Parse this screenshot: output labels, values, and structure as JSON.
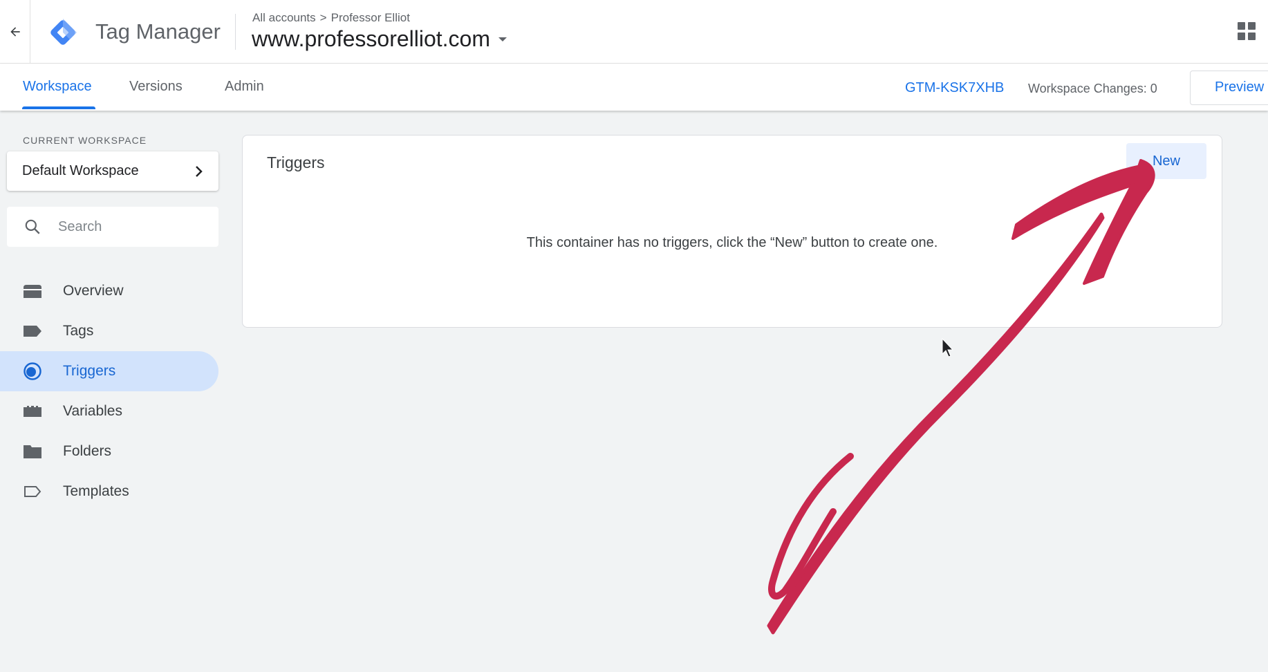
{
  "header": {
    "app_name": "Tag Manager",
    "breadcrumb": {
      "accounts": "All accounts",
      "separator": ">",
      "account": "Professor Elliot"
    },
    "container_name": "www.professorelliot.com"
  },
  "tabs": {
    "workspace": "Workspace",
    "versions": "Versions",
    "admin": "Admin",
    "active": "Workspace"
  },
  "toolbar": {
    "container_id": "GTM-KSK7XHB",
    "workspace_changes": "Workspace Changes: 0",
    "preview_label": "Preview"
  },
  "sidebar": {
    "current_workspace_label": "CURRENT WORKSPACE",
    "workspace_name": "Default Workspace",
    "search_placeholder": "Search",
    "items": [
      {
        "label": "Overview",
        "icon": "overview-icon"
      },
      {
        "label": "Tags",
        "icon": "tag-icon"
      },
      {
        "label": "Triggers",
        "icon": "trigger-icon",
        "active": true
      },
      {
        "label": "Variables",
        "icon": "variables-icon"
      },
      {
        "label": "Folders",
        "icon": "folder-icon"
      },
      {
        "label": "Templates",
        "icon": "template-icon"
      }
    ]
  },
  "main": {
    "card_title": "Triggers",
    "new_button": "New",
    "empty_message": "This container has no triggers, click the “New” button to create one."
  },
  "colors": {
    "accent": "#1a73e8",
    "active_nav_bg": "#d2e3fc",
    "annotation_arrow": "#c8284e"
  }
}
